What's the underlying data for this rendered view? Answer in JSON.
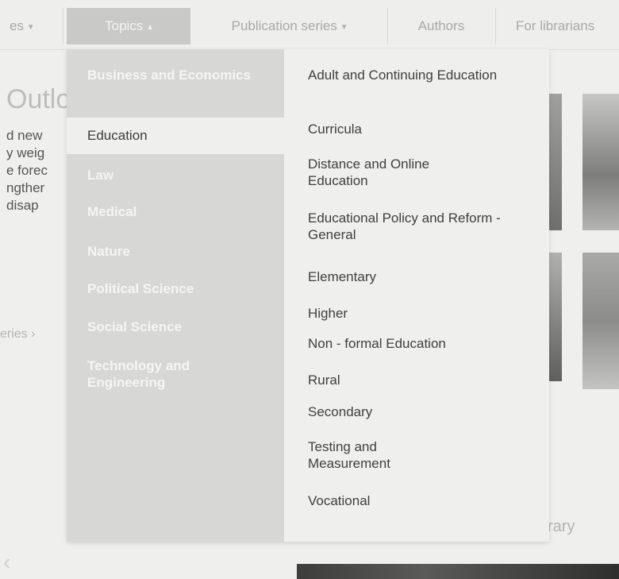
{
  "nav": {
    "series_cut": "es",
    "topics": "Topics",
    "publication_series": "Publication series",
    "authors": "Authors",
    "librarians": "For librarians",
    "caret_down": "▾",
    "caret_up": "▴"
  },
  "background": {
    "heading_cut": "Outlo",
    "para_lines": [
      "d new",
      "y weig",
      "e forec",
      "ngther",
      "disap"
    ],
    "series_cut": "eries ›",
    "library_cut": "rary",
    "left_chevron": "‹"
  },
  "dropdown": {
    "topics": [
      {
        "label": "Business and Economics"
      },
      {
        "label": "Education"
      },
      {
        "label": "Law"
      },
      {
        "label": "Medical"
      },
      {
        "label": "Nature"
      },
      {
        "label": "Political Science"
      },
      {
        "label": "Social Science"
      },
      {
        "label": "Technology and Engineering"
      }
    ],
    "active_topic": "Education",
    "subtopics": [
      {
        "label": "Adult and Continuing Education"
      },
      {
        "label": "Curricula"
      },
      {
        "label": "Distance and Online Education"
      },
      {
        "label": "Educational Policy and Reform - General"
      },
      {
        "label": "Elementary"
      },
      {
        "label": "Higher"
      },
      {
        "label": "Non - formal Education"
      },
      {
        "label": "Rural"
      },
      {
        "label": "Secondary"
      },
      {
        "label": "Testing and Measurement"
      },
      {
        "label": "Vocational"
      }
    ]
  }
}
